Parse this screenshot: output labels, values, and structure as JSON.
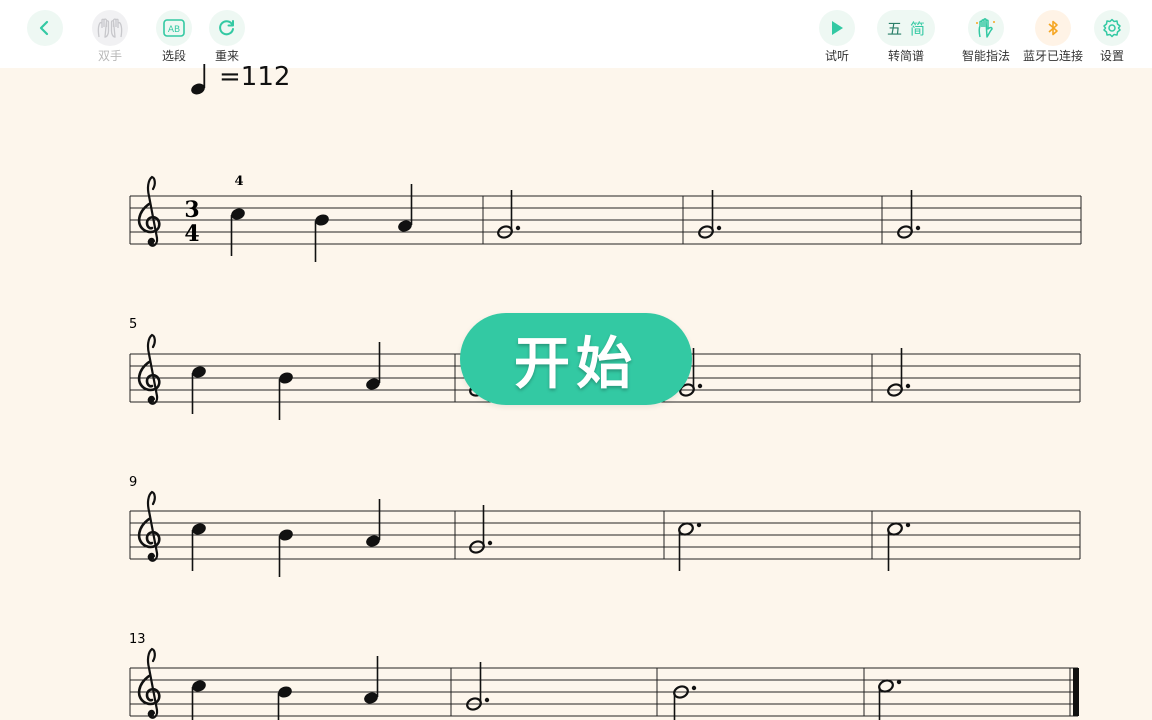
{
  "toolbar": {
    "left": [
      {
        "name": "both-hands",
        "label": "双手",
        "icon": "hands-icon",
        "disabled": true
      },
      {
        "name": "section",
        "label": "选段",
        "icon": "ab-section-icon",
        "disabled": false
      },
      {
        "name": "restart",
        "label": "重来",
        "icon": "refresh-icon",
        "disabled": false
      }
    ],
    "right": [
      {
        "name": "listen",
        "label": "试听",
        "icon": "play-icon"
      },
      {
        "name": "convert",
        "label": "转简谱",
        "icon": "notation-convert-icon",
        "glyph1": "五",
        "glyph2": "简"
      },
      {
        "name": "fingering",
        "label": "智能指法",
        "icon": "hand-fingering-icon"
      },
      {
        "name": "bluetooth",
        "label": "蓝牙已连接",
        "icon": "bluetooth-icon"
      },
      {
        "name": "settings",
        "label": "设置",
        "icon": "gear-icon"
      }
    ],
    "accent": "#33c9a3"
  },
  "score": {
    "tempo": "=112",
    "time_signature": {
      "top": "3",
      "bottom": "4"
    },
    "fingering_mark": "4",
    "measure_numbers": [
      "5",
      "9",
      "13"
    ]
  },
  "overlay": {
    "start_label": "开始"
  }
}
